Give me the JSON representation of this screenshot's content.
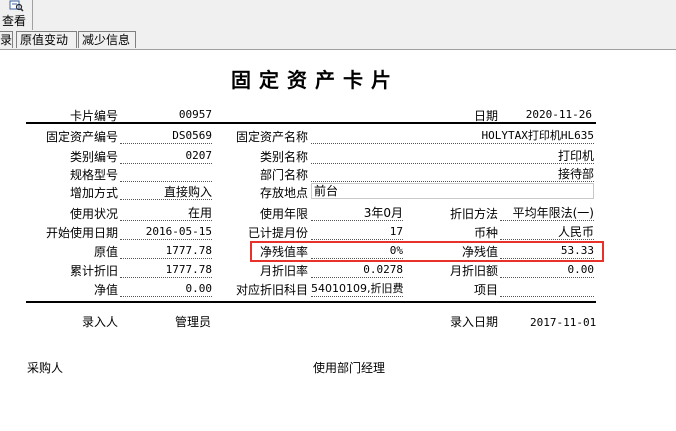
{
  "toolbar": {
    "view_label": "查看"
  },
  "tabs": [
    "录",
    "原值变动",
    "减少信息"
  ],
  "card": {
    "title": "固定资产卡片",
    "card_no": {
      "label": "卡片编号",
      "value": "00957"
    },
    "date": {
      "label": "日期",
      "value": "2020-11-26"
    },
    "rows": {
      "asset_code": {
        "label": "固定资产编号",
        "value": "DS0569"
      },
      "asset_name": {
        "label": "固定资产名称",
        "value": "HOLYTAX打印机HL635"
      },
      "category_code": {
        "label": "类别编号",
        "value": "0207"
      },
      "category_name": {
        "label": "类别名称",
        "value": "打印机"
      },
      "spec_model": {
        "label": "规格型号",
        "value": ""
      },
      "department": {
        "label": "部门名称",
        "value": "接待部"
      },
      "add_method": {
        "label": "增加方式",
        "value": "直接购入"
      },
      "location": {
        "label": "存放地点",
        "value": "前台"
      },
      "use_status": {
        "label": "使用状况",
        "value": "在用"
      },
      "use_years": {
        "label": "使用年限",
        "value": "3年0月"
      },
      "depr_method": {
        "label": "折旧方法",
        "value": "平均年限法(一)"
      },
      "start_date": {
        "label": "开始使用日期",
        "value": "2016-05-15"
      },
      "months_accrued": {
        "label": "已计提月份",
        "value": "17"
      },
      "currency": {
        "label": "币种",
        "value": "人民币"
      },
      "original_value": {
        "label": "原值",
        "value": "1777.78"
      },
      "salvage_rate": {
        "label": "净残值率",
        "value": "0%"
      },
      "salvage_value": {
        "label": "净残值",
        "value": "53.33"
      },
      "accum_depr": {
        "label": "累计折旧",
        "value": "1777.78"
      },
      "monthly_rate": {
        "label": "月折旧率",
        "value": "0.0278"
      },
      "monthly_amount": {
        "label": "月折旧额",
        "value": "0.00"
      },
      "net_value": {
        "label": "净值",
        "value": "0.00"
      },
      "depr_account": {
        "label": "对应折旧科目",
        "value": "54010109,折旧费"
      },
      "project": {
        "label": "项目",
        "value": ""
      }
    },
    "entry_person": {
      "label": "录入人",
      "value": "管理员"
    },
    "entry_date": {
      "label": "录入日期",
      "value": "2017-11-01"
    },
    "purchaser": {
      "label": "采购人"
    },
    "dept_manager": {
      "label": "使用部门经理"
    }
  },
  "colors": {
    "highlight": "#e8312a"
  }
}
